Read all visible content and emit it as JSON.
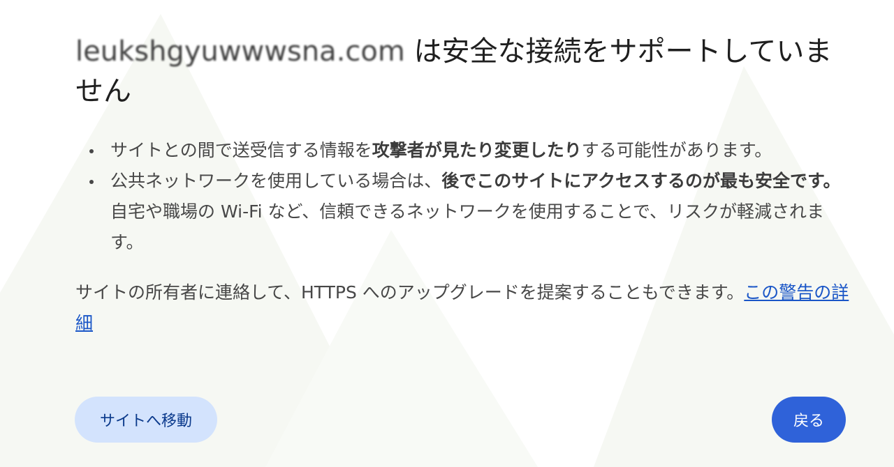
{
  "heading": {
    "domain": "leukshgyuwwwsna.com",
    "text": " は安全な接続をサポートしていません"
  },
  "bullets": [
    {
      "parts": [
        {
          "text": "サイトとの間で送受信する情報を",
          "bold": false
        },
        {
          "text": "攻撃者が見たり変更したり",
          "bold": true
        },
        {
          "text": "する可能性があります。",
          "bold": false
        }
      ]
    },
    {
      "parts": [
        {
          "text": "公共ネットワークを使用している場合は、",
          "bold": false
        },
        {
          "text": "後でこのサイトにアクセスするのが最も安全です。",
          "bold": true
        },
        {
          "text": "自宅や職場の Wi-Fi など、信頼できるネットワークを使用することで、リスクが軽減されます。",
          "bold": false
        }
      ]
    }
  ],
  "help": {
    "text": "サイトの所有者に連絡して、HTTPS へのアップグレードを提案することもできます。",
    "link": "この警告の詳細"
  },
  "buttons": {
    "proceed": "サイトへ移動",
    "back": "戻る"
  },
  "colors": {
    "primary": "#2f62d9",
    "secondary_bg": "#d3e3fd",
    "link": "#1a56c7"
  }
}
